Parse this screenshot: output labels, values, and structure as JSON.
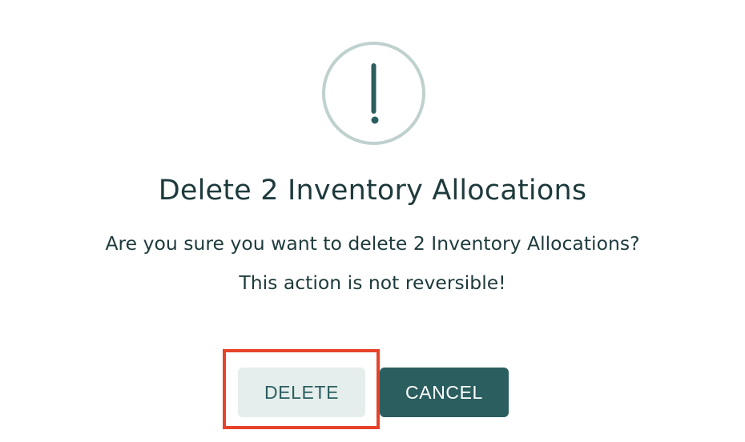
{
  "dialog": {
    "icon": "exclamation-icon",
    "title": "Delete 2 Inventory Allocations",
    "message_line1": "Are you sure you want to delete 2 Inventory Allocations?",
    "message_line2": "This action is not reversible!",
    "buttons": {
      "delete_label": "DELETE",
      "cancel_label": "CANCEL"
    }
  },
  "colors": {
    "accent": "#2b5e5f",
    "ring": "#bfd1cf",
    "secondary_button_bg": "#e5eeec",
    "text": "#1e3a3c",
    "highlight": "#e6432a"
  }
}
